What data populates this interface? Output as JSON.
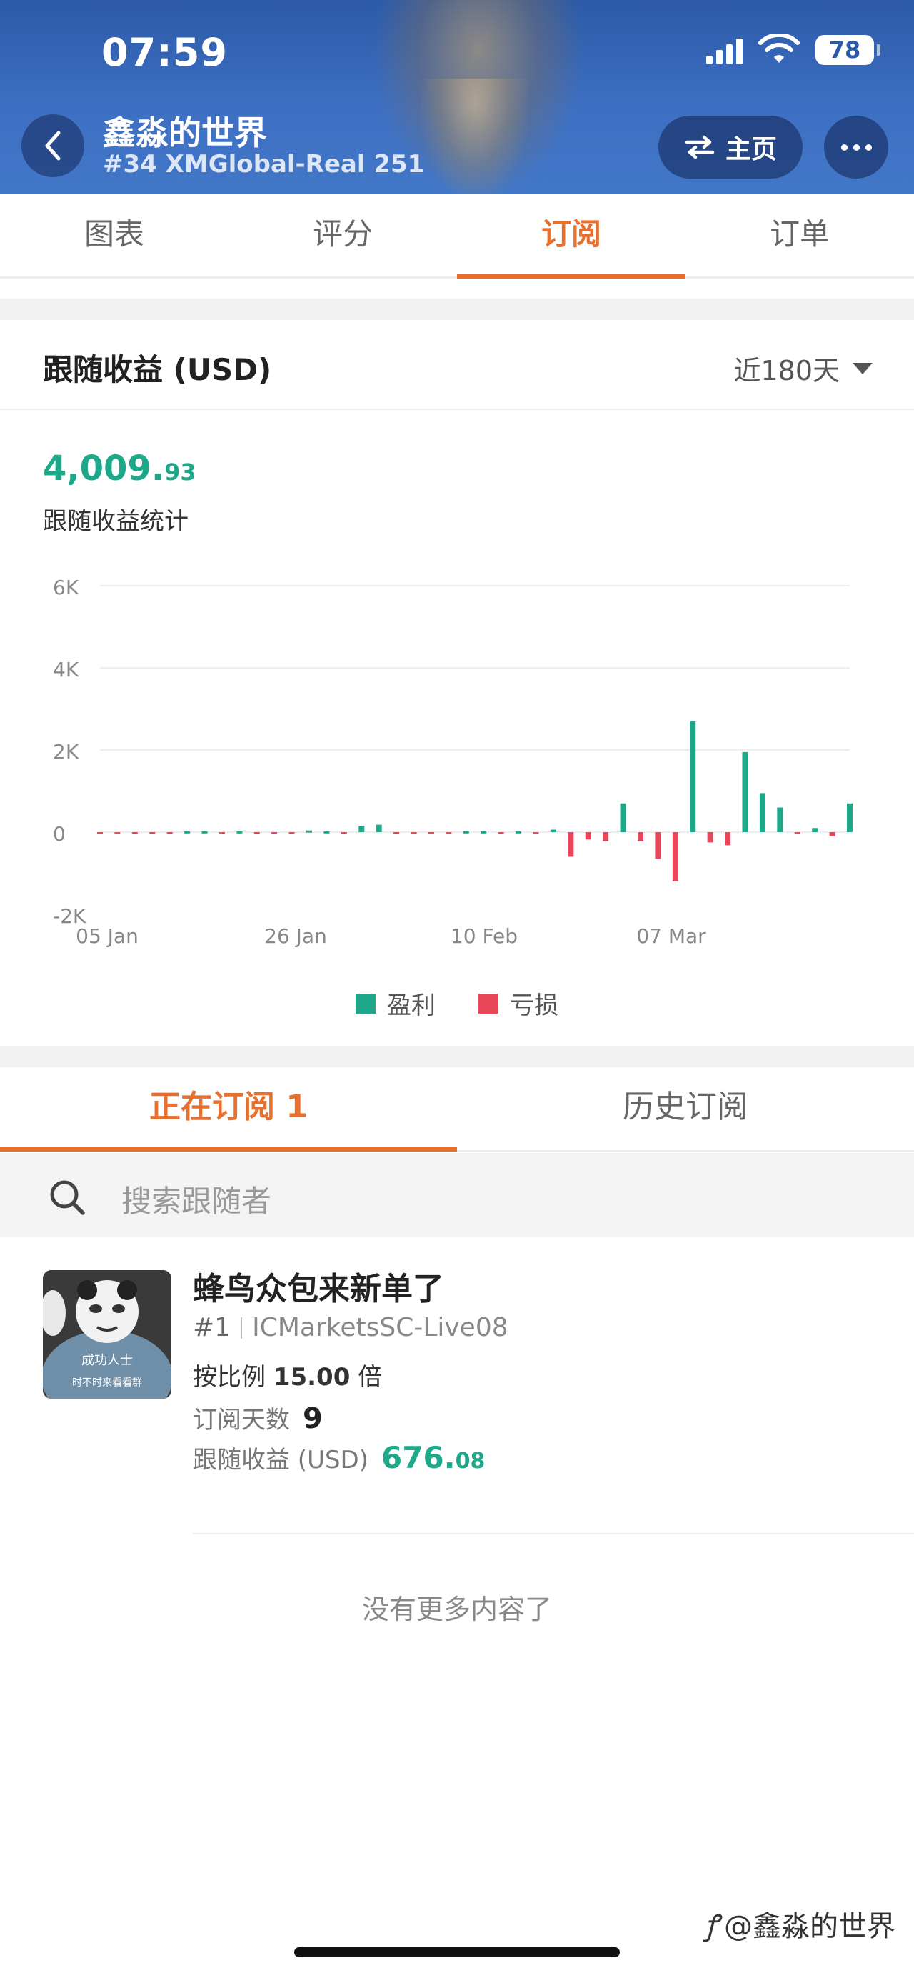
{
  "status_bar": {
    "time": "07:59",
    "battery": "78"
  },
  "header": {
    "title": "鑫淼的世界",
    "subtitle": "#34 XMGlobal-Real 251",
    "home_label": "主页",
    "accent_color": "#2c5aa8"
  },
  "top_tabs": [
    {
      "label": "图表",
      "active": false
    },
    {
      "label": "评分",
      "active": false
    },
    {
      "label": "订阅",
      "active": true
    },
    {
      "label": "订单",
      "active": false
    }
  ],
  "follow_income": {
    "title": "跟随收益 (USD)",
    "range": "近180天",
    "amount_int": "4,009.",
    "amount_dec": "93",
    "amount_label": "跟随收益统计",
    "legend": {
      "profit": "盈利",
      "loss": "亏损"
    },
    "profit_color": "#1ea88a",
    "loss_color": "#e8475a"
  },
  "chart_data": {
    "type": "bar",
    "y_ticks": [
      "6K",
      "4K",
      "2K",
      "0",
      "-2K"
    ],
    "x_ticks": [
      "05 Jan",
      "26 Jan",
      "10 Feb",
      "07 Mar"
    ],
    "ylim": [
      -2000,
      6000
    ],
    "grid": true,
    "legend_position": "bottom",
    "series": [
      {
        "name": "盈利",
        "color": "#1ea88a"
      },
      {
        "name": "亏损",
        "color": "#e8475a"
      }
    ],
    "values": [
      -20,
      -20,
      -20,
      -20,
      -20,
      20,
      20,
      -20,
      20,
      -20,
      -20,
      -20,
      40,
      20,
      -20,
      150,
      180,
      -20,
      -20,
      -20,
      -20,
      20,
      20,
      -20,
      20,
      -20,
      60,
      -600,
      -180,
      -220,
      700,
      -220,
      -650,
      -1200,
      2700,
      -250,
      -320,
      1950,
      950,
      600,
      -50,
      100,
      -100,
      700
    ]
  },
  "subscription_tabs": [
    {
      "label": "正在订阅 1",
      "active": true
    },
    {
      "label": "历史订阅",
      "active": false
    }
  ],
  "search": {
    "placeholder": "搜索跟随者"
  },
  "followers": [
    {
      "name": "蜂鸟众包来新单了",
      "rank": "#1",
      "account": "ICMarketsSC-Live08",
      "ratio_prefix": "按比例",
      "ratio_value": "15.00",
      "ratio_suffix": "倍",
      "days_label": "订阅天数",
      "days_value": "9",
      "income_label": "跟随收益 (USD)",
      "income_int": "676.",
      "income_dec": "08",
      "avatar_text_1": "成功人士",
      "avatar_text_2": "时不时来看看群"
    }
  ],
  "no_more": "没有更多内容了",
  "watermark": "@鑫淼的世界"
}
